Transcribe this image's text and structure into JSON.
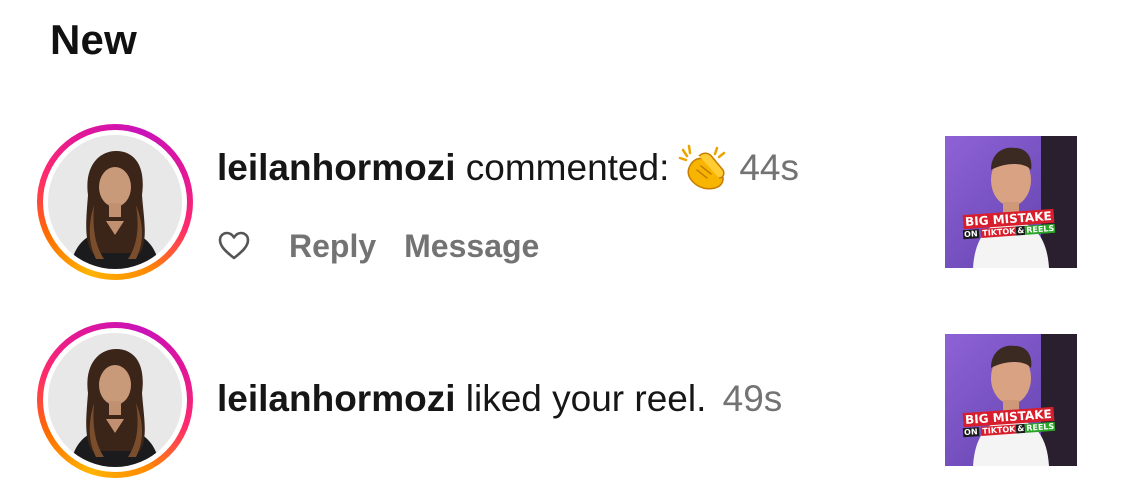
{
  "section": {
    "title": "New"
  },
  "notifications": [
    {
      "username": "leilanhormozi",
      "action_text": "commented:",
      "comment_icon": "clapping-hands-emoji",
      "time": "44s",
      "actions": {
        "reply_label": "Reply",
        "message_label": "Message",
        "like_icon": "heart-outline-icon"
      },
      "thumbnail": {
        "line1": "BIG MISTAKE",
        "line2_a": "ON",
        "line2_b": "TIKTOK",
        "line2_c": "&",
        "line2_d": "REELS"
      }
    },
    {
      "username": "leilanhormozi",
      "action_text": "liked your reel.",
      "time": "49s",
      "thumbnail": {
        "line1": "BIG MISTAKE",
        "line2_a": "ON",
        "line2_b": "TIKTOK",
        "line2_c": "&",
        "line2_d": "REELS"
      }
    }
  ],
  "colors": {
    "story_ring": [
      "#ffb400",
      "#ff2a6d",
      "#c913b9"
    ],
    "meta_text": "#737373",
    "thumb_bg": "#7a58c2"
  }
}
